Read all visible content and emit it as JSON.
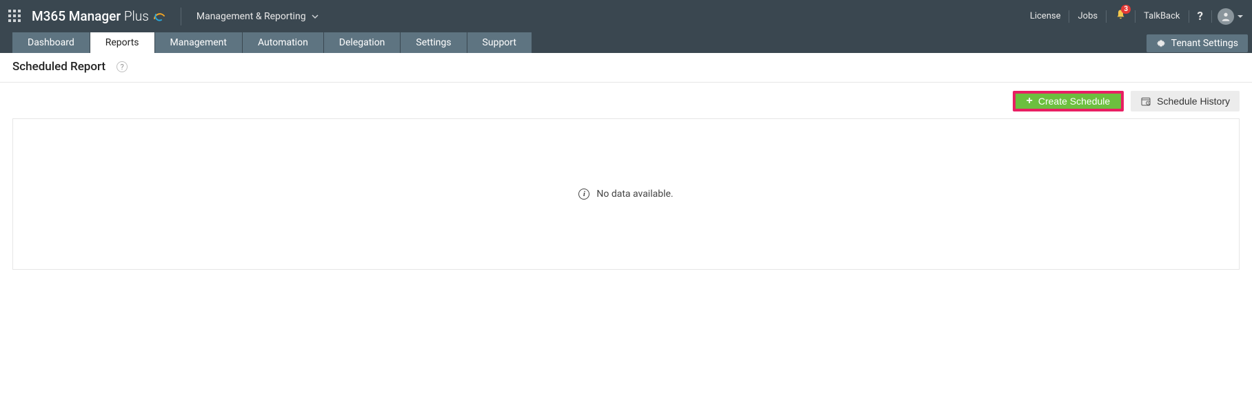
{
  "header": {
    "brand_prefix": "M365 Manager",
    "brand_suffix": "Plus",
    "context_label": "Management & Reporting",
    "links": {
      "license": "License",
      "jobs": "Jobs",
      "talkback": "TalkBack"
    },
    "notification_count": "3"
  },
  "nav": {
    "tabs": [
      {
        "label": "Dashboard"
      },
      {
        "label": "Reports"
      },
      {
        "label": "Management"
      },
      {
        "label": "Automation"
      },
      {
        "label": "Delegation"
      },
      {
        "label": "Settings"
      },
      {
        "label": "Support"
      }
    ],
    "active_index": 1,
    "tenant_settings": "Tenant Settings"
  },
  "page": {
    "title": "Scheduled Report",
    "help_tooltip": "?"
  },
  "actions": {
    "create_schedule": "Create Schedule",
    "schedule_history": "Schedule History"
  },
  "content": {
    "no_data": "No data available."
  }
}
